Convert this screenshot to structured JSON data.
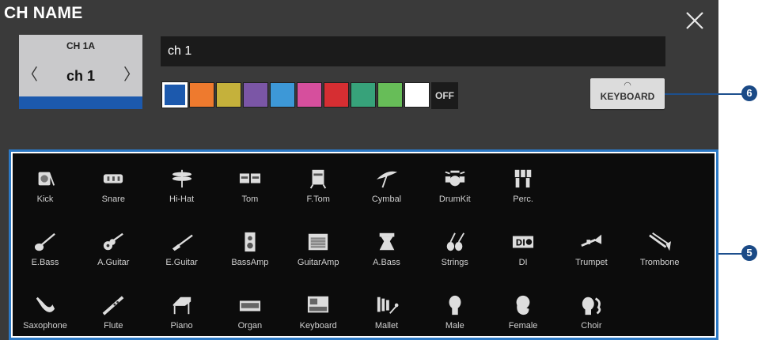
{
  "dialog": {
    "title": "CH NAME"
  },
  "channel": {
    "id": "CH 1A",
    "name": "ch 1",
    "color": "#1c59ad"
  },
  "name_input": {
    "value": "ch 1"
  },
  "colors": [
    "#1c59ad",
    "#ee7a2e",
    "#c5b13b",
    "#7b56a6",
    "#3d98d7",
    "#d64f9d",
    "#d62e32",
    "#37a27a",
    "#67bd58",
    "#ffffff"
  ],
  "selected_color_index": 0,
  "off_label": "OFF",
  "keyboard_button": {
    "label": "KEYBOARD"
  },
  "callouts": {
    "keyboard": "6",
    "icons": "5"
  },
  "icons": [
    [
      {
        "label": "Kick",
        "icon": "kick-drum-icon"
      },
      {
        "label": "Snare",
        "icon": "snare-drum-icon"
      },
      {
        "label": "Hi-Hat",
        "icon": "hi-hat-icon"
      },
      {
        "label": "Tom",
        "icon": "tom-icon"
      },
      {
        "label": "F.Tom",
        "icon": "floor-tom-icon"
      },
      {
        "label": "Cymbal",
        "icon": "cymbal-icon"
      },
      {
        "label": "DrumKit",
        "icon": "drum-kit-icon"
      },
      {
        "label": "Perc.",
        "icon": "percussion-icon"
      }
    ],
    [
      {
        "label": "E.Bass",
        "icon": "electric-bass-icon"
      },
      {
        "label": "A.Guitar",
        "icon": "acoustic-guitar-icon"
      },
      {
        "label": "E.Guitar",
        "icon": "electric-guitar-icon"
      },
      {
        "label": "BassAmp",
        "icon": "bass-amp-icon"
      },
      {
        "label": "GuitarAmp",
        "icon": "guitar-amp-icon"
      },
      {
        "label": "A.Bass",
        "icon": "acoustic-bass-icon"
      },
      {
        "label": "Strings",
        "icon": "strings-icon"
      },
      {
        "label": "DI",
        "icon": "di-box-icon"
      },
      {
        "label": "Trumpet",
        "icon": "trumpet-icon"
      },
      {
        "label": "Trombone",
        "icon": "trombone-icon"
      }
    ],
    [
      {
        "label": "Saxophone",
        "icon": "saxophone-icon"
      },
      {
        "label": "Flute",
        "icon": "flute-icon"
      },
      {
        "label": "Piano",
        "icon": "piano-icon"
      },
      {
        "label": "Organ",
        "icon": "organ-icon"
      },
      {
        "label": "Keyboard",
        "icon": "keyboard-instrument-icon"
      },
      {
        "label": "Mallet",
        "icon": "mallet-icon"
      },
      {
        "label": "Male",
        "icon": "male-vocal-icon"
      },
      {
        "label": "Female",
        "icon": "female-vocal-icon"
      },
      {
        "label": "Choir",
        "icon": "choir-icon"
      }
    ]
  ]
}
